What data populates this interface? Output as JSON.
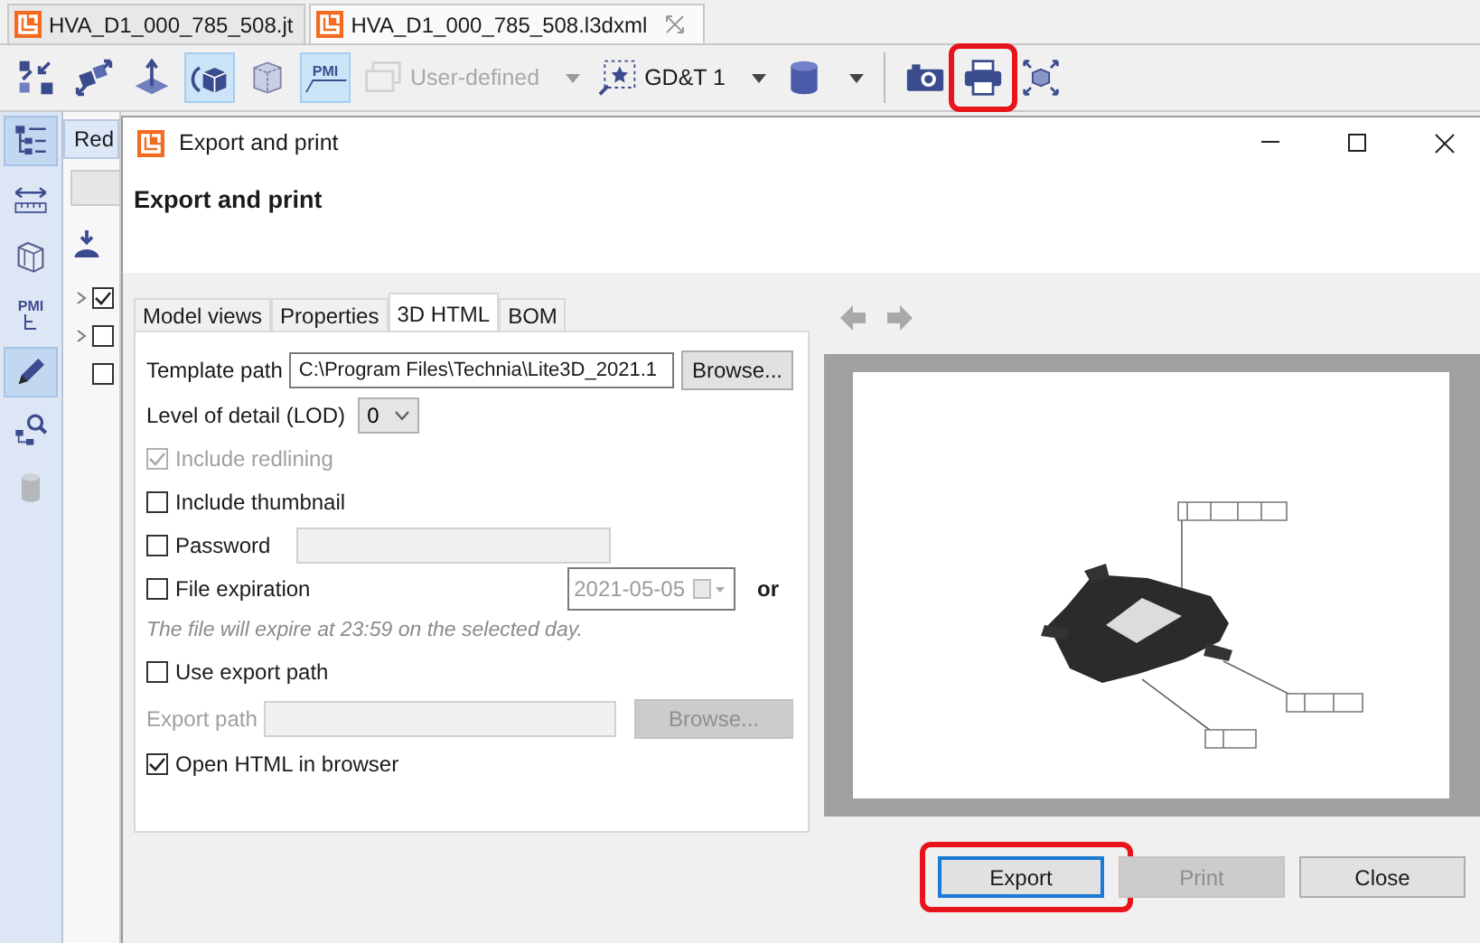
{
  "editor_tabs": [
    {
      "label": "HVA_D1_000_785_508.jt",
      "selected": false,
      "closable": false
    },
    {
      "label": "HVA_D1_000_785_508.l3dxml",
      "selected": true,
      "closable": true
    }
  ],
  "toolbar": [
    {
      "kind": "icon",
      "selected": false,
      "highlighted": false
    },
    {
      "kind": "icon",
      "selected": false,
      "highlighted": false
    },
    {
      "kind": "icon",
      "selected": false,
      "highlighted": false
    },
    {
      "kind": "icon",
      "selected": true,
      "highlighted": false
    },
    {
      "kind": "icon",
      "selected": false,
      "highlighted": false
    },
    {
      "kind": "icon",
      "label": "PMI",
      "selected": true,
      "highlighted": false
    },
    {
      "kind": "dropdown",
      "label": "User-defined",
      "disabled": true
    },
    {
      "kind": "dropdown",
      "label": "GD&T 1",
      "disabled": false
    },
    {
      "kind": "dropdown",
      "disabled": false
    },
    {
      "kind": "separator"
    },
    {
      "kind": "icon",
      "selected": false,
      "highlighted": false
    },
    {
      "kind": "icon",
      "selected": false,
      "highlighted": true
    },
    {
      "kind": "icon",
      "selected": false,
      "highlighted": false
    }
  ],
  "sidebar": [
    {
      "selected": true,
      "disabled": false
    },
    {
      "selected": false,
      "disabled": false
    },
    {
      "selected": false,
      "disabled": false
    },
    {
      "label": "PMI",
      "selected": false,
      "disabled": false
    },
    {
      "selected": true,
      "disabled": false
    },
    {
      "selected": false,
      "disabled": false
    },
    {
      "selected": false,
      "disabled": true
    }
  ],
  "back_panel": {
    "tab": "Red",
    "tree": [
      {
        "expandable": true,
        "checked": true
      },
      {
        "expandable": true,
        "checked": false
      },
      {
        "expandable": false,
        "checked": false
      }
    ]
  },
  "dialog": {
    "title": "Export and print",
    "heading": "Export and print",
    "tabs": [
      {
        "label": "Model views",
        "selected": false
      },
      {
        "label": "Properties",
        "selected": false
      },
      {
        "label": "3D HTML",
        "selected": true
      },
      {
        "label": "BOM",
        "selected": false
      }
    ],
    "form": [
      {
        "kind": "path",
        "label": "Template path",
        "value": "C:\\Program Files\\Technia\\Lite3D_2021.1",
        "button": "Browse...",
        "disabled": false
      },
      {
        "kind": "select",
        "label": "Level of detail (LOD)",
        "value": "0"
      },
      {
        "kind": "check",
        "label": "Include redlining",
        "checked": true,
        "disabled": true
      },
      {
        "kind": "check",
        "label": "Include thumbnail",
        "checked": false,
        "disabled": false
      },
      {
        "kind": "check_field",
        "label": "Password",
        "checked": false,
        "disabled": false
      },
      {
        "kind": "check_date",
        "label": "File expiration",
        "checked": false,
        "disabled": false,
        "date": "2021-05-05",
        "suffix": "or"
      },
      {
        "kind": "hint",
        "text": "The file will expire at 23:59 on the selected day."
      },
      {
        "kind": "check",
        "label": "Use export path",
        "checked": false,
        "disabled": false
      },
      {
        "kind": "path",
        "label": "Export path",
        "button": "Browse...",
        "disabled": true
      },
      {
        "kind": "check",
        "label": "Open HTML in browser",
        "checked": true,
        "disabled": false
      }
    ],
    "buttons": [
      {
        "label": "Export",
        "disabled": false,
        "focused": true,
        "highlighted": true
      },
      {
        "label": "Print",
        "disabled": true,
        "focused": false,
        "highlighted": false
      },
      {
        "label": "Close",
        "disabled": false,
        "focused": false,
        "highlighted": false
      }
    ]
  }
}
